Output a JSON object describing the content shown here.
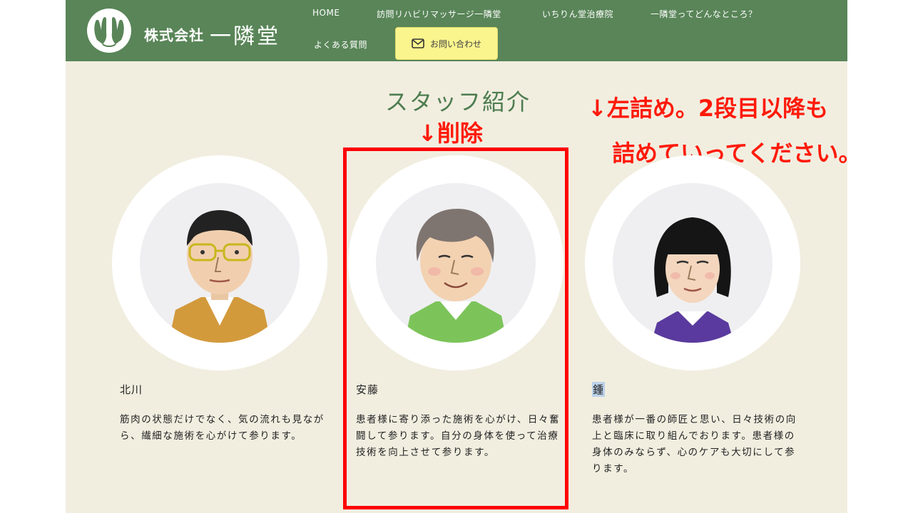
{
  "header": {
    "company_prefix": "株式会社",
    "company_name": "一隣堂",
    "nav": [
      {
        "label": "HOME"
      },
      {
        "label": "訪問リハビリマッサージ一隣堂"
      },
      {
        "label": "いちりん堂治療院"
      },
      {
        "label": "一隣堂ってどんなところ？"
      },
      {
        "label": "よくある質問"
      }
    ],
    "contact_label": "お問い合わせ"
  },
  "section": {
    "title": "スタッフ紹介"
  },
  "annotations": {
    "delete_note": "↓削除",
    "left_note_line1": "↓左詰め。2段目以降も",
    "left_note_line2": "詰めていってください。"
  },
  "staff": [
    {
      "name": "北川",
      "description": "筋肉の状態だけでなく、気の流れも見ながら、繊細な施術を心がけて参ります。"
    },
    {
      "name": "安藤",
      "description": "患者様に寄り添った施術を心がけ、日々奮闘して参ります。自分の身体を使って治療技術を向上させて参ります。"
    },
    {
      "name": "鍾",
      "description": "患者様が一番の師匠と思い、日々技術の向上と臨床に取り組んでおります。患者様の身体のみならず、心のケアも大切にして参ります。"
    }
  ],
  "colors": {
    "header_bg": "#598558",
    "page_bg": "#f1eee0",
    "title_green": "#4e7d50",
    "contact_btn_bg": "#fbf58e",
    "annotation_red": "#ff1a0a"
  },
  "icons": {
    "logo": "hands-logo-icon",
    "contact": "mail-icon"
  }
}
